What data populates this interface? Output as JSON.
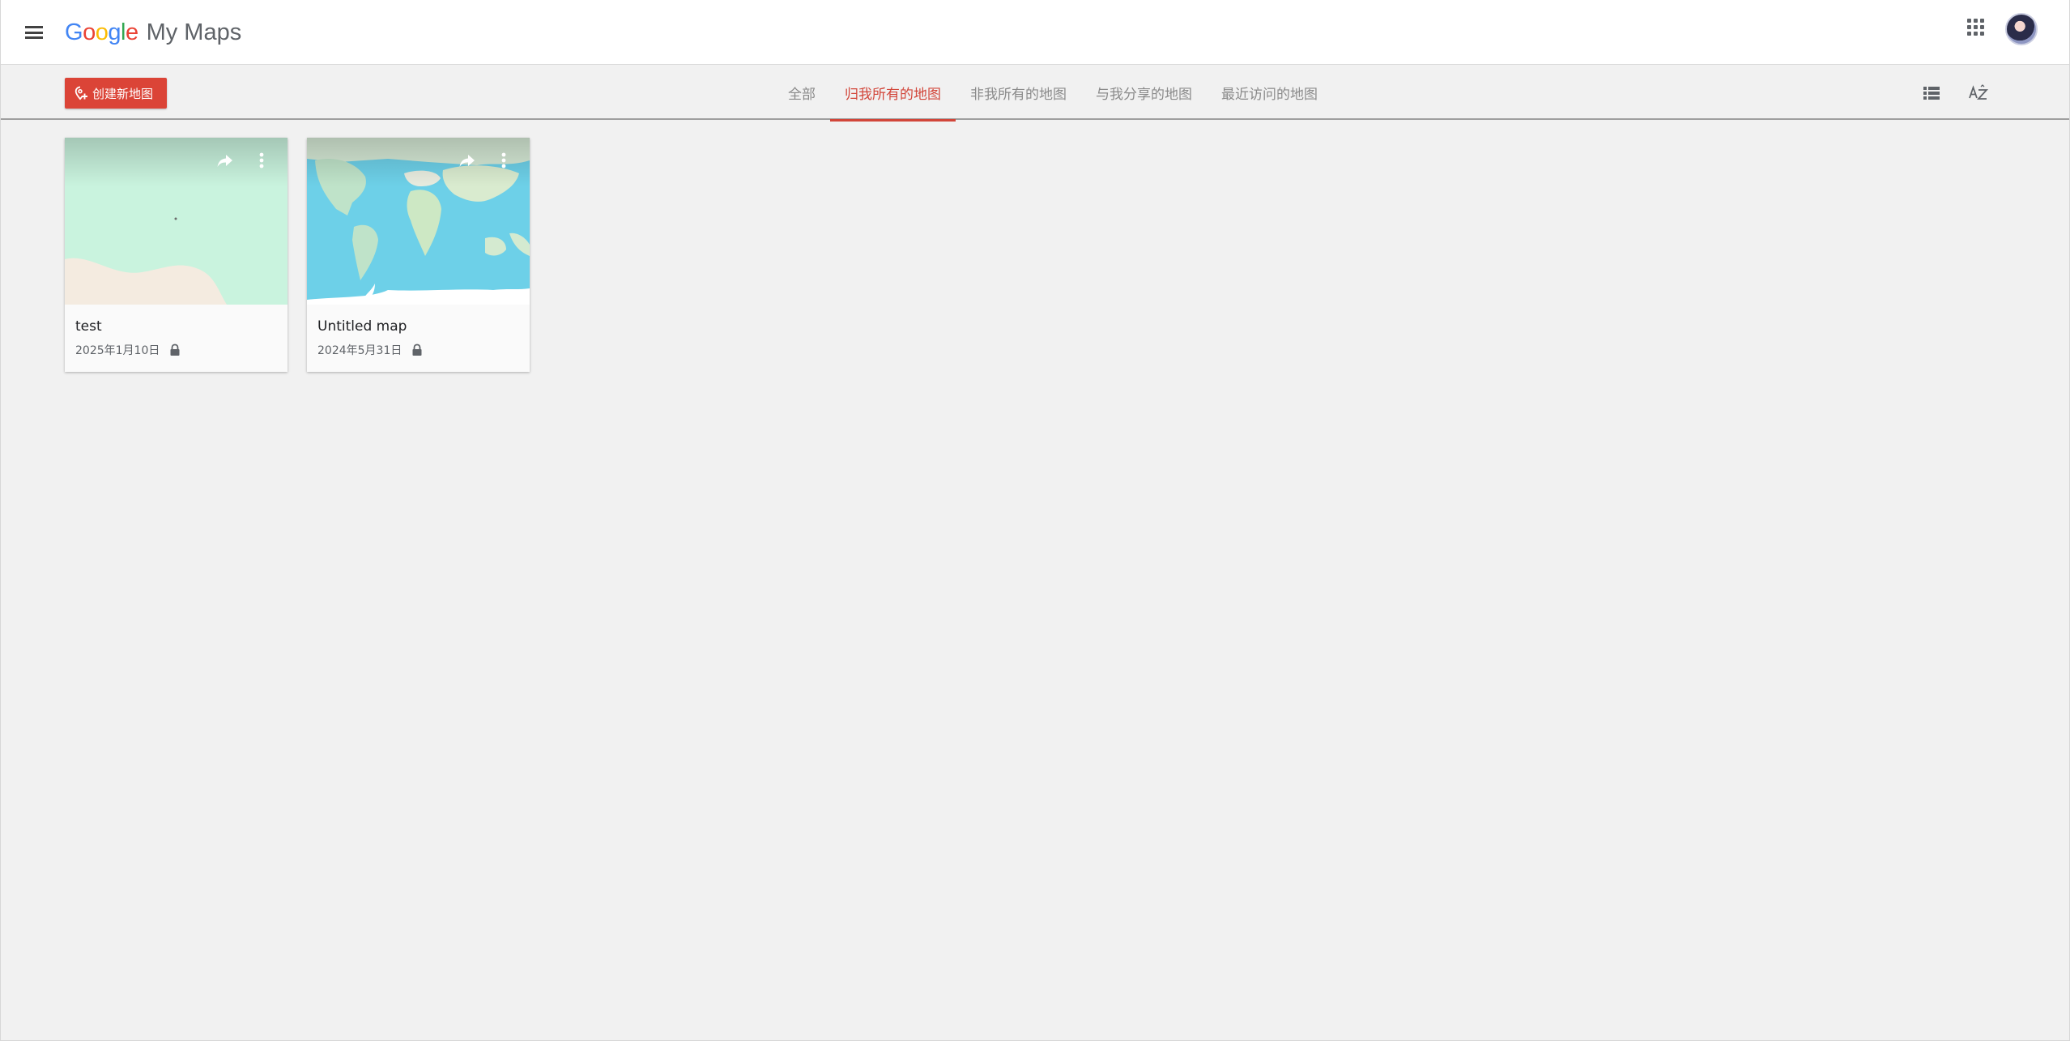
{
  "header": {
    "brand_letters": [
      {
        "char": "G",
        "color": "#4285F4"
      },
      {
        "char": "o",
        "color": "#EA4335"
      },
      {
        "char": "o",
        "color": "#FBBC05"
      },
      {
        "char": "g",
        "color": "#4285F4"
      },
      {
        "char": "l",
        "color": "#34A853"
      },
      {
        "char": "e",
        "color": "#EA4335"
      }
    ],
    "product_name": "My Maps",
    "menu_icon": "hamburger-menu-icon",
    "apps_icon": "apps-grid-icon",
    "avatar_icon": "user-avatar"
  },
  "toolbar": {
    "create_label": "创建新地图",
    "create_icon": "add-map-icon",
    "tabs": [
      {
        "label": "全部",
        "active": false
      },
      {
        "label": "归我所有的地图",
        "active": true
      },
      {
        "label": "非我所有的地图",
        "active": false
      },
      {
        "label": "与我分享的地图",
        "active": false
      },
      {
        "label": "最近访问的地图",
        "active": false
      }
    ],
    "list_view_icon": "list-view-icon",
    "sort_icon": "sort-az-icon"
  },
  "maps": [
    {
      "title": "test",
      "date": "2025年1月10日",
      "private": true
    },
    {
      "title": "Untitled map",
      "date": "2024年5月31日",
      "private": true
    }
  ],
  "colors": {
    "accent": "#db4437",
    "active_tab": "#d2463a",
    "page_bg": "#f1f1f1"
  }
}
